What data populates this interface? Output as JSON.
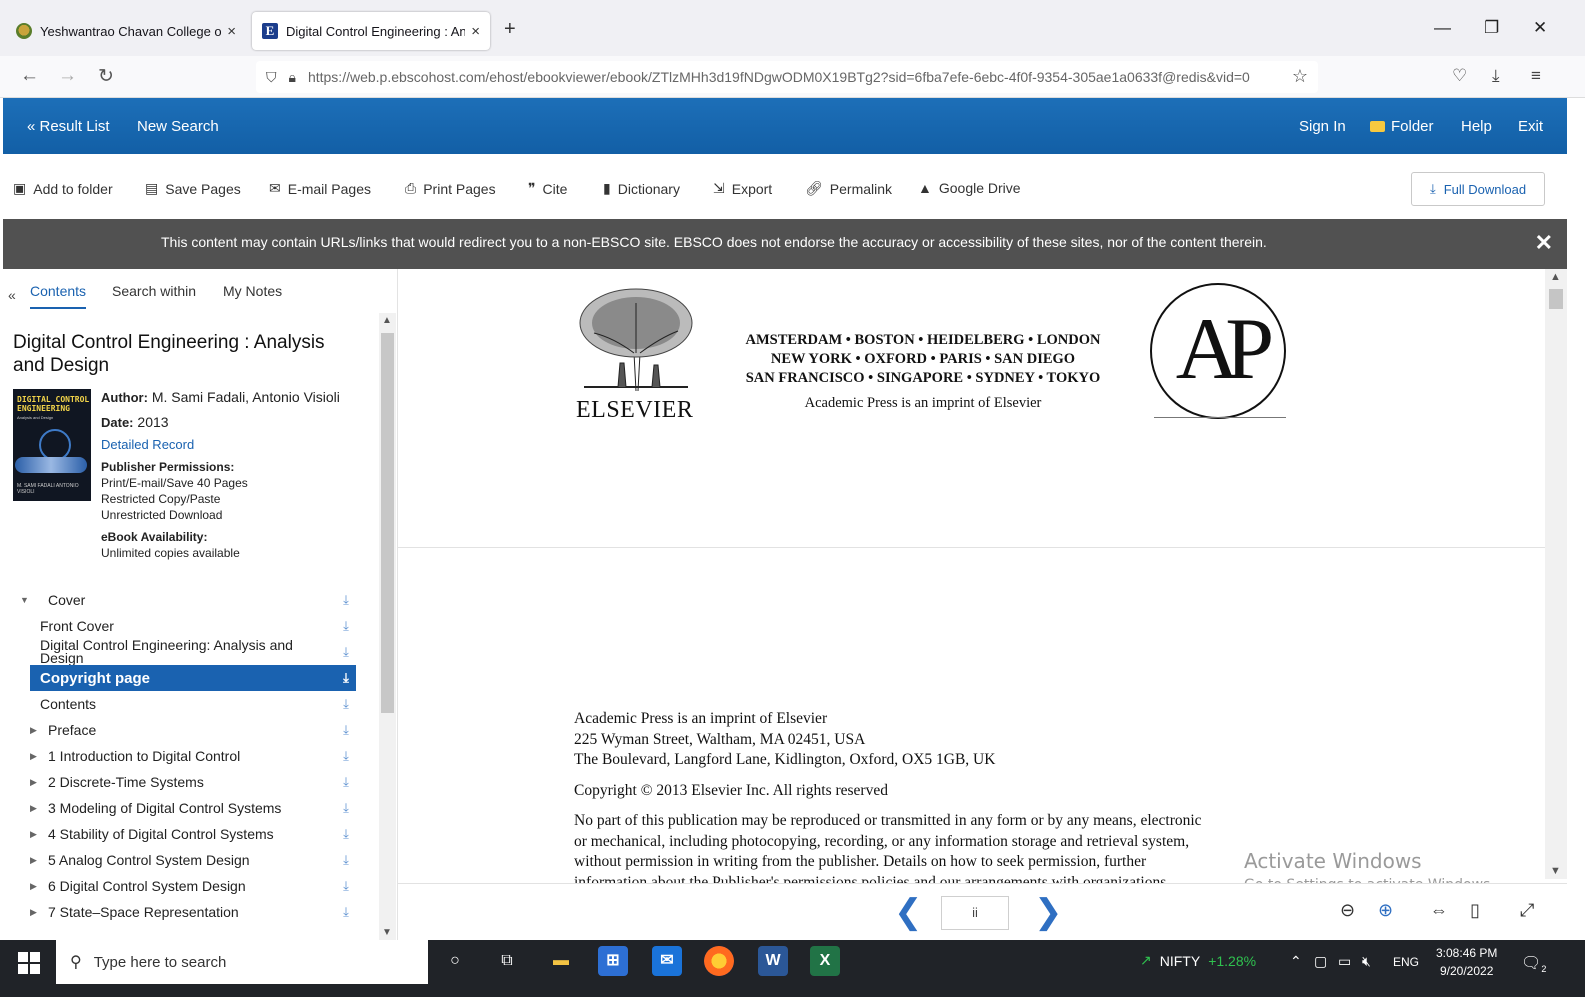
{
  "browser": {
    "tabs": [
      {
        "title": "Yeshwantrao Chavan College of"
      },
      {
        "title": "Digital Control Engineering : An"
      }
    ],
    "tab_close": "×",
    "new_tab": "+",
    "url": "https://web.p.ebscohost.com/ehost/ebookviewer/ebook/ZTlzMHh3d19fNDgwODM0X19BTg2?sid=6fba7efe-6ebc-4f0f-9354-305ae1a0633f@redis&vid=0",
    "window_controls": {
      "minimize": "—",
      "restore": "❐",
      "close": "✕"
    }
  },
  "header": {
    "result_list": "« Result List",
    "new_search": "New Search",
    "sign_in": "Sign In",
    "folder": "Folder",
    "help": "Help",
    "exit": "Exit",
    "brand_color": "#1466ae"
  },
  "toolbar": {
    "add_to_folder": "Add to folder",
    "save_pages": "Save Pages",
    "email_pages": "E-mail Pages",
    "print_pages": "Print Pages",
    "cite": "Cite",
    "dictionary": "Dictionary",
    "export": "Export",
    "permalink": "Permalink",
    "google_drive": "Google Drive",
    "full_download": "Full Download"
  },
  "notice": {
    "text": "This content may contain URLs/links that would redirect you to a non-EBSCO site. EBSCO does not endorse the accuracy or accessibility of these sites, nor of the content therein.",
    "close": "✕"
  },
  "sidebar": {
    "collapse": "«",
    "tabs": [
      "Contents",
      "Search within",
      "My Notes"
    ],
    "book": {
      "title": "Digital Control Engineering : Analysis and Design",
      "cover_text": "DIGITAL CONTROL ENGINEERING",
      "cover_subtitle": "Analysis and Design",
      "cover_authors": "M. SAMI FADALI   ANTONIO VISIOLI",
      "author_label": "Author:",
      "author_value": "M. Sami Fadali, Antonio Visioli",
      "date_label": "Date:",
      "date_value": "2013",
      "detailed_record": "Detailed Record",
      "permissions_label": "Publisher Permissions:",
      "permissions": [
        "Print/E-mail/Save 40 Pages",
        "Restricted Copy/Paste",
        "Unrestricted Download"
      ],
      "availability_label": "eBook Availability:",
      "availability_value": "Unlimited copies available"
    },
    "toc": [
      {
        "label": "Cover",
        "arrow": "▼"
      },
      {
        "label": "Front Cover",
        "arrow": ""
      },
      {
        "label": "Digital Control Engineering: Analysis and Design",
        "arrow": ""
      },
      {
        "label": "Copyright page",
        "arrow": "",
        "active": true
      },
      {
        "label": "Contents",
        "arrow": ""
      },
      {
        "label": "Preface",
        "arrow": "▶"
      },
      {
        "label": "1 Introduction to Digital Control",
        "arrow": "▶"
      },
      {
        "label": "2 Discrete-Time Systems",
        "arrow": "▶"
      },
      {
        "label": "3 Modeling of Digital Control Systems",
        "arrow": "▶"
      },
      {
        "label": "4 Stability of Digital Control Systems",
        "arrow": "▶"
      },
      {
        "label": "5 Analog Control System Design",
        "arrow": "▶"
      },
      {
        "label": "6 Digital Control System Design",
        "arrow": "▶"
      },
      {
        "label": "7 State–Space Representation",
        "arrow": "▶"
      }
    ]
  },
  "reader": {
    "elsevier": "ELSEVIER",
    "cities": [
      "AMSTERDAM • BOSTON • HEIDELBERG • LONDON",
      "NEW YORK • OXFORD • PARIS • SAN DIEGO",
      "SAN FRANCISCO • SINGAPORE • SYDNEY • TOKYO"
    ],
    "imprint": "Academic Press is an imprint of Elsevier",
    "ap_logo": "AP",
    "page2": {
      "address": [
        "Academic Press is an imprint of Elsevier",
        "225 Wyman Street, Waltham, MA 02451, USA",
        "The Boulevard, Langford Lane, Kidlington, Oxford, OX5 1GB, UK"
      ],
      "copyright": "Copyright © 2013 Elsevier Inc. All rights reserved",
      "rights": [
        "No part of this publication may be reproduced or transmitted in any form or by any means, electronic",
        "or mechanical, including photocopying, recording, or any information storage and retrieval system,",
        "without permission in writing from the publisher. Details on how to seek permission, further",
        "information about the Publisher's permissions policies and our arrangements with organizations"
      ]
    },
    "page_indicator": "ii",
    "activate_title": "Activate Windows",
    "activate_sub": "Go to Settings to activate Windows."
  },
  "taskbar": {
    "search_placeholder": "Type here to search",
    "nifty_label": "NIFTY",
    "nifty_change": "+1.28%",
    "lang": "ENG",
    "time": "3:08:46 PM",
    "date": "9/20/2022",
    "notification_count": "2"
  }
}
